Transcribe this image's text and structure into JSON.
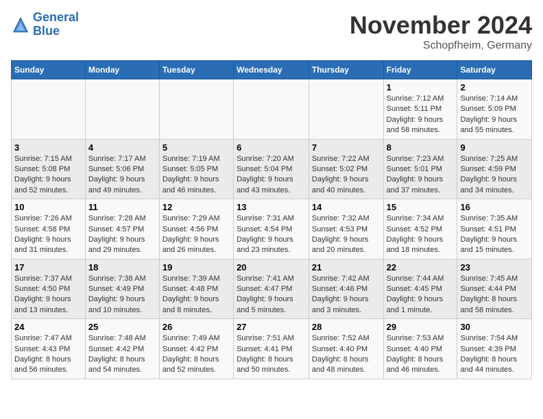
{
  "header": {
    "logo_line1": "General",
    "logo_line2": "Blue",
    "month": "November 2024",
    "location": "Schopfheim, Germany"
  },
  "weekdays": [
    "Sunday",
    "Monday",
    "Tuesday",
    "Wednesday",
    "Thursday",
    "Friday",
    "Saturday"
  ],
  "weeks": [
    {
      "days": [
        {
          "num": "",
          "info": ""
        },
        {
          "num": "",
          "info": ""
        },
        {
          "num": "",
          "info": ""
        },
        {
          "num": "",
          "info": ""
        },
        {
          "num": "",
          "info": ""
        },
        {
          "num": "1",
          "info": "Sunrise: 7:12 AM\nSunset: 5:11 PM\nDaylight: 9 hours and 58 minutes."
        },
        {
          "num": "2",
          "info": "Sunrise: 7:14 AM\nSunset: 5:09 PM\nDaylight: 9 hours and 55 minutes."
        }
      ]
    },
    {
      "days": [
        {
          "num": "3",
          "info": "Sunrise: 7:15 AM\nSunset: 5:08 PM\nDaylight: 9 hours and 52 minutes."
        },
        {
          "num": "4",
          "info": "Sunrise: 7:17 AM\nSunset: 5:06 PM\nDaylight: 9 hours and 49 minutes."
        },
        {
          "num": "5",
          "info": "Sunrise: 7:19 AM\nSunset: 5:05 PM\nDaylight: 9 hours and 46 minutes."
        },
        {
          "num": "6",
          "info": "Sunrise: 7:20 AM\nSunset: 5:04 PM\nDaylight: 9 hours and 43 minutes."
        },
        {
          "num": "7",
          "info": "Sunrise: 7:22 AM\nSunset: 5:02 PM\nDaylight: 9 hours and 40 minutes."
        },
        {
          "num": "8",
          "info": "Sunrise: 7:23 AM\nSunset: 5:01 PM\nDaylight: 9 hours and 37 minutes."
        },
        {
          "num": "9",
          "info": "Sunrise: 7:25 AM\nSunset: 4:59 PM\nDaylight: 9 hours and 34 minutes."
        }
      ]
    },
    {
      "days": [
        {
          "num": "10",
          "info": "Sunrise: 7:26 AM\nSunset: 4:58 PM\nDaylight: 9 hours and 31 minutes."
        },
        {
          "num": "11",
          "info": "Sunrise: 7:28 AM\nSunset: 4:57 PM\nDaylight: 9 hours and 29 minutes."
        },
        {
          "num": "12",
          "info": "Sunrise: 7:29 AM\nSunset: 4:56 PM\nDaylight: 9 hours and 26 minutes."
        },
        {
          "num": "13",
          "info": "Sunrise: 7:31 AM\nSunset: 4:54 PM\nDaylight: 9 hours and 23 minutes."
        },
        {
          "num": "14",
          "info": "Sunrise: 7:32 AM\nSunset: 4:53 PM\nDaylight: 9 hours and 20 minutes."
        },
        {
          "num": "15",
          "info": "Sunrise: 7:34 AM\nSunset: 4:52 PM\nDaylight: 9 hours and 18 minutes."
        },
        {
          "num": "16",
          "info": "Sunrise: 7:35 AM\nSunset: 4:51 PM\nDaylight: 9 hours and 15 minutes."
        }
      ]
    },
    {
      "days": [
        {
          "num": "17",
          "info": "Sunrise: 7:37 AM\nSunset: 4:50 PM\nDaylight: 9 hours and 13 minutes."
        },
        {
          "num": "18",
          "info": "Sunrise: 7:38 AM\nSunset: 4:49 PM\nDaylight: 9 hours and 10 minutes."
        },
        {
          "num": "19",
          "info": "Sunrise: 7:39 AM\nSunset: 4:48 PM\nDaylight: 9 hours and 8 minutes."
        },
        {
          "num": "20",
          "info": "Sunrise: 7:41 AM\nSunset: 4:47 PM\nDaylight: 9 hours and 5 minutes."
        },
        {
          "num": "21",
          "info": "Sunrise: 7:42 AM\nSunset: 4:46 PM\nDaylight: 9 hours and 3 minutes."
        },
        {
          "num": "22",
          "info": "Sunrise: 7:44 AM\nSunset: 4:45 PM\nDaylight: 9 hours and 1 minute."
        },
        {
          "num": "23",
          "info": "Sunrise: 7:45 AM\nSunset: 4:44 PM\nDaylight: 8 hours and 58 minutes."
        }
      ]
    },
    {
      "days": [
        {
          "num": "24",
          "info": "Sunrise: 7:47 AM\nSunset: 4:43 PM\nDaylight: 8 hours and 56 minutes."
        },
        {
          "num": "25",
          "info": "Sunrise: 7:48 AM\nSunset: 4:42 PM\nDaylight: 8 hours and 54 minutes."
        },
        {
          "num": "26",
          "info": "Sunrise: 7:49 AM\nSunset: 4:42 PM\nDaylight: 8 hours and 52 minutes."
        },
        {
          "num": "27",
          "info": "Sunrise: 7:51 AM\nSunset: 4:41 PM\nDaylight: 8 hours and 50 minutes."
        },
        {
          "num": "28",
          "info": "Sunrise: 7:52 AM\nSunset: 4:40 PM\nDaylight: 8 hours and 48 minutes."
        },
        {
          "num": "29",
          "info": "Sunrise: 7:53 AM\nSunset: 4:40 PM\nDaylight: 8 hours and 46 minutes."
        },
        {
          "num": "30",
          "info": "Sunrise: 7:54 AM\nSunset: 4:39 PM\nDaylight: 8 hours and 44 minutes."
        }
      ]
    }
  ]
}
